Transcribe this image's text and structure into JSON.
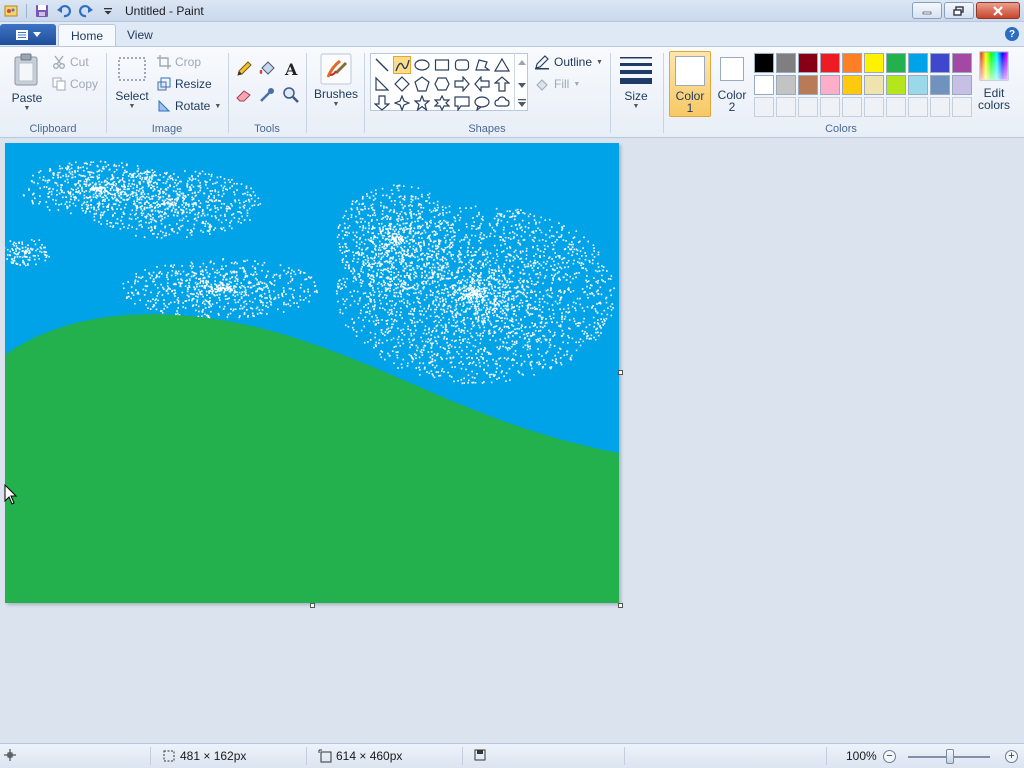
{
  "window": {
    "title": "Untitled - Paint",
    "titlebar_color": "#c9d8ec"
  },
  "quick_access": {
    "icons": [
      "save-icon",
      "undo-icon",
      "redo-icon",
      "customize-dropdown-icon"
    ]
  },
  "tabs": [
    {
      "label": "Home",
      "active": true
    },
    {
      "label": "View",
      "active": false
    }
  ],
  "ribbon": {
    "clipboard": {
      "label": "Clipboard",
      "paste": "Paste",
      "cut": "Cut",
      "copy": "Copy"
    },
    "image": {
      "label": "Image",
      "select": "Select",
      "crop": "Crop",
      "resize": "Resize",
      "rotate": "Rotate"
    },
    "tools": {
      "label": "Tools",
      "items": [
        "pencil-icon",
        "fill-bucket-icon",
        "text-icon",
        "eraser-icon",
        "color-picker-icon",
        "magnifier-icon"
      ]
    },
    "brushes": {
      "label": "Brushes"
    },
    "shapes": {
      "label": "Shapes",
      "outline": "Outline",
      "fill": "Fill",
      "selected": "curve"
    },
    "size": {
      "label": "Size"
    },
    "colors": {
      "label": "Colors",
      "color1": "Color 1",
      "color1_line1": "Color",
      "color1_line2": "1",
      "color2_line1": "Color",
      "color2_line2": "2",
      "color1_value": "#ffffff",
      "color2_value": "#ffffff",
      "edit_line1": "Edit",
      "edit_line2": "colors",
      "palette_row1": [
        "#000000",
        "#7f7f7f",
        "#880015",
        "#ed1c24",
        "#ff7f27",
        "#fff200",
        "#22b14c",
        "#00a2e8",
        "#3f48cc",
        "#a349a4"
      ],
      "palette_row2": [
        "#ffffff",
        "#c3c3c3",
        "#b97a57",
        "#ffaec9",
        "#ffc90e",
        "#efe4b0",
        "#b5e61d",
        "#99d9ea",
        "#7092be",
        "#c8bfe7"
      ]
    }
  },
  "canvas": {
    "sky_color": "#00a2e8",
    "grass_color": "#22b14c",
    "cloud_color": "#ffffff"
  },
  "status": {
    "cursor_pos": "481 × 162px",
    "canvas_size": "614 × 460px",
    "zoom": "100%",
    "zoom_level": 1.0
  }
}
